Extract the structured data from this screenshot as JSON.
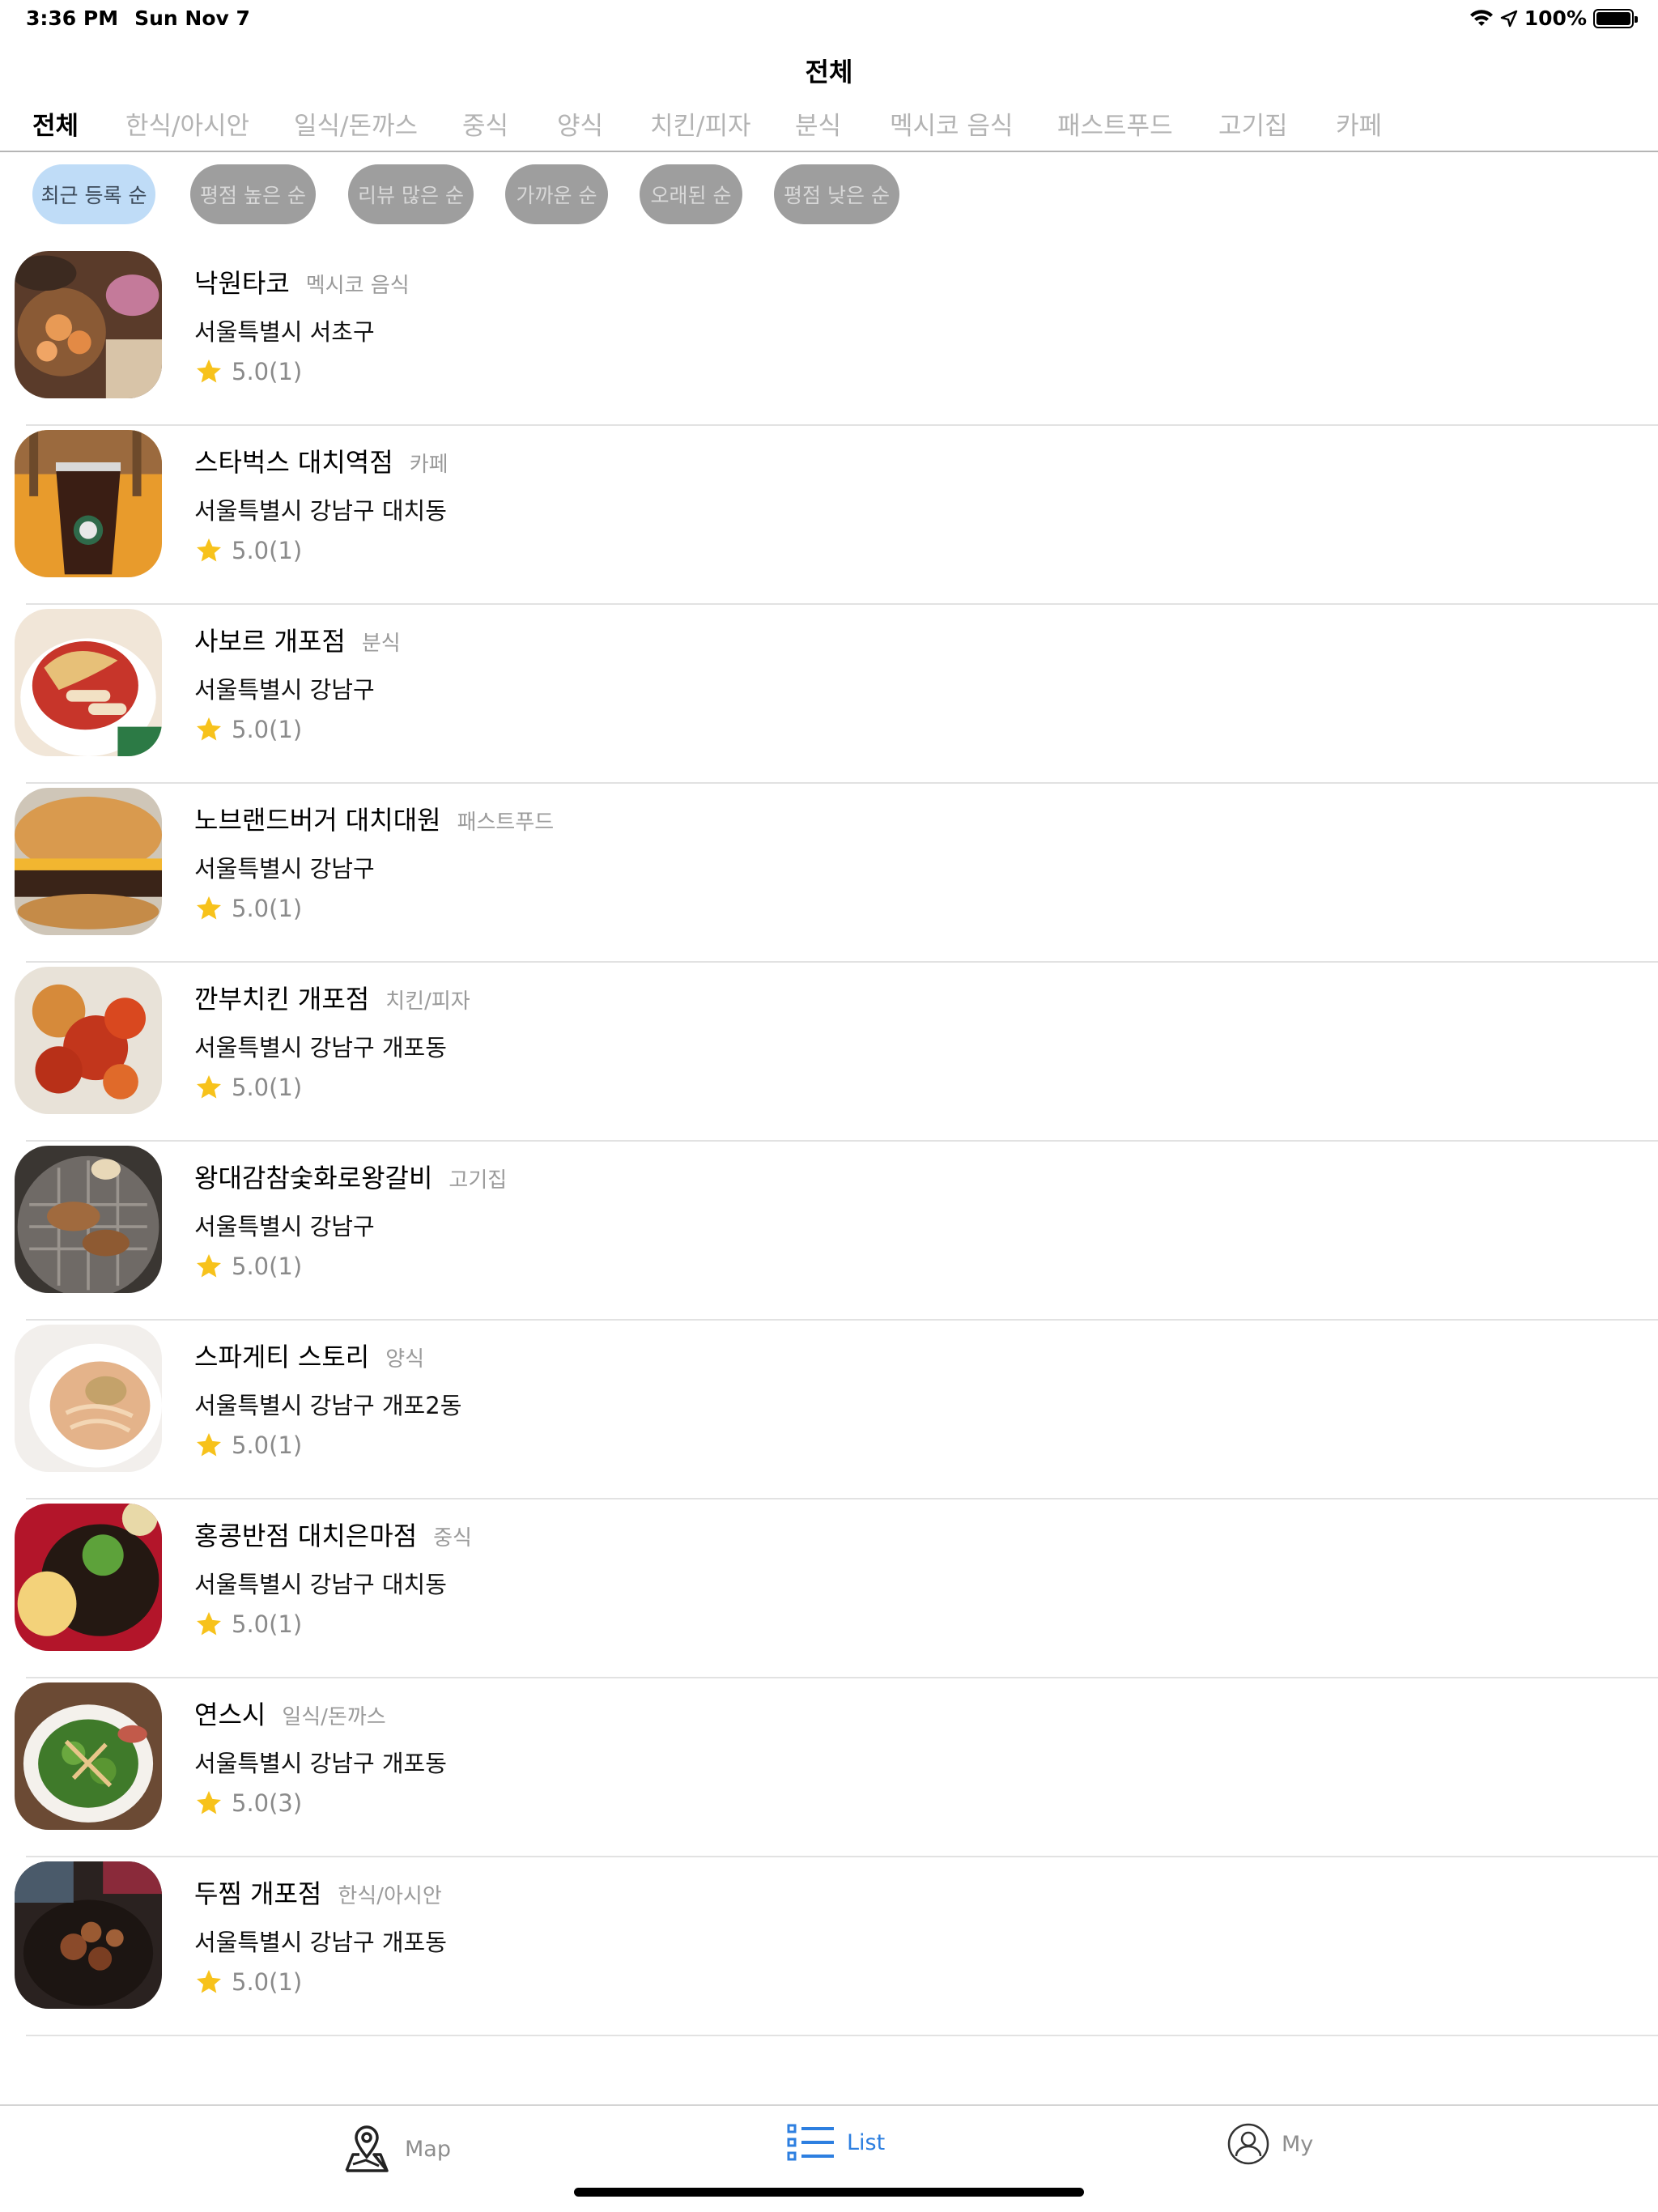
{
  "status_bar": {
    "time": "3:36 PM",
    "date": "Sun Nov 7",
    "battery": "100%"
  },
  "nav": {
    "title": "전체"
  },
  "categories": [
    "전체",
    "한식/아시안",
    "일식/돈까스",
    "중식",
    "양식",
    "치킨/피자",
    "분식",
    "멕시코 음식",
    "패스트푸드",
    "고기집",
    "카페"
  ],
  "sort_options": [
    "최근 등록 순",
    "평점 높은 순",
    "리뷰 많은 순",
    "가까운 순",
    "오래된 순",
    "평점 낮은 순"
  ],
  "restaurants": [
    {
      "name": "낙원타코",
      "category": "멕시코 음식",
      "address": "서울특별시 서초구",
      "rating": "5.0(1)"
    },
    {
      "name": "스타벅스 대치역점",
      "category": "카페",
      "address": "서울특별시 강남구 대치동",
      "rating": "5.0(1)"
    },
    {
      "name": "사보르 개포점",
      "category": "분식",
      "address": "서울특별시 강남구",
      "rating": "5.0(1)"
    },
    {
      "name": "노브랜드버거 대치대원",
      "category": "패스트푸드",
      "address": "서울특별시 강남구",
      "rating": "5.0(1)"
    },
    {
      "name": "깐부치킨 개포점",
      "category": "치킨/피자",
      "address": "서울특별시 강남구 개포동",
      "rating": "5.0(1)"
    },
    {
      "name": "왕대감참숯화로왕갈비",
      "category": "고기집",
      "address": "서울특별시 강남구",
      "rating": "5.0(1)"
    },
    {
      "name": "스파게티 스토리",
      "category": "양식",
      "address": "서울특별시 강남구 개포2동",
      "rating": "5.0(1)"
    },
    {
      "name": "홍콩반점 대치은마점",
      "category": "중식",
      "address": "서울특별시 강남구 대치동",
      "rating": "5.0(1)"
    },
    {
      "name": "연스시",
      "category": "일식/돈까스",
      "address": "서울특별시 강남구 개포동",
      "rating": "5.0(3)"
    },
    {
      "name": "두찜 개포점",
      "category": "한식/아시안",
      "address": "서울특별시 강남구 개포동",
      "rating": "5.0(1)"
    }
  ],
  "tabbar": {
    "map": "Map",
    "list": "List",
    "my": "My"
  },
  "colors": {
    "accent": "#2d7fe0",
    "chip_active": "#bfdcf7",
    "chip_inactive": "#9e9e9e",
    "star": "#f7c21b"
  }
}
